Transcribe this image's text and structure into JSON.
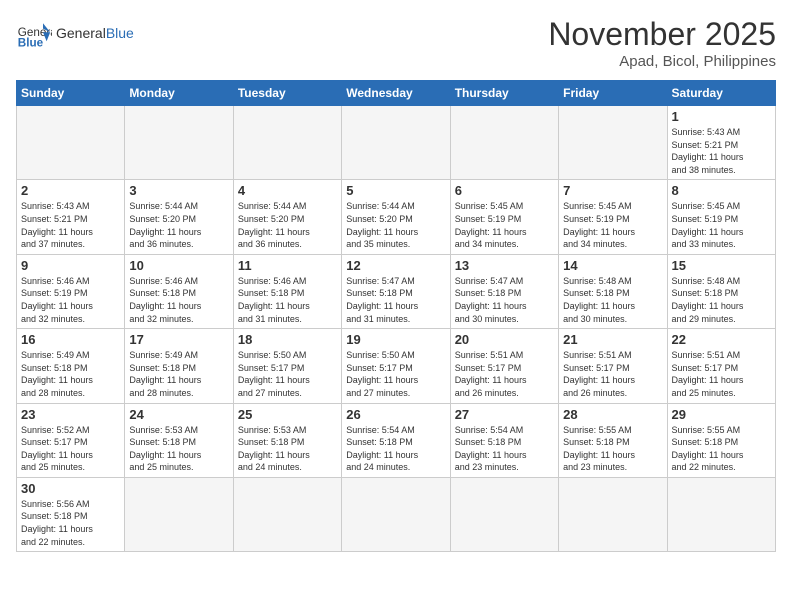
{
  "header": {
    "logo_general": "General",
    "logo_blue": "Blue",
    "month_title": "November 2025",
    "location": "Apad, Bicol, Philippines"
  },
  "weekdays": [
    "Sunday",
    "Monday",
    "Tuesday",
    "Wednesday",
    "Thursday",
    "Friday",
    "Saturday"
  ],
  "days": [
    {
      "num": "",
      "info": ""
    },
    {
      "num": "",
      "info": ""
    },
    {
      "num": "",
      "info": ""
    },
    {
      "num": "",
      "info": ""
    },
    {
      "num": "",
      "info": ""
    },
    {
      "num": "",
      "info": ""
    },
    {
      "num": "1",
      "info": "Sunrise: 5:43 AM\nSunset: 5:21 PM\nDaylight: 11 hours\nand 38 minutes."
    },
    {
      "num": "2",
      "info": "Sunrise: 5:43 AM\nSunset: 5:21 PM\nDaylight: 11 hours\nand 37 minutes."
    },
    {
      "num": "3",
      "info": "Sunrise: 5:44 AM\nSunset: 5:20 PM\nDaylight: 11 hours\nand 36 minutes."
    },
    {
      "num": "4",
      "info": "Sunrise: 5:44 AM\nSunset: 5:20 PM\nDaylight: 11 hours\nand 36 minutes."
    },
    {
      "num": "5",
      "info": "Sunrise: 5:44 AM\nSunset: 5:20 PM\nDaylight: 11 hours\nand 35 minutes."
    },
    {
      "num": "6",
      "info": "Sunrise: 5:45 AM\nSunset: 5:19 PM\nDaylight: 11 hours\nand 34 minutes."
    },
    {
      "num": "7",
      "info": "Sunrise: 5:45 AM\nSunset: 5:19 PM\nDaylight: 11 hours\nand 34 minutes."
    },
    {
      "num": "8",
      "info": "Sunrise: 5:45 AM\nSunset: 5:19 PM\nDaylight: 11 hours\nand 33 minutes."
    },
    {
      "num": "9",
      "info": "Sunrise: 5:46 AM\nSunset: 5:19 PM\nDaylight: 11 hours\nand 32 minutes."
    },
    {
      "num": "10",
      "info": "Sunrise: 5:46 AM\nSunset: 5:18 PM\nDaylight: 11 hours\nand 32 minutes."
    },
    {
      "num": "11",
      "info": "Sunrise: 5:46 AM\nSunset: 5:18 PM\nDaylight: 11 hours\nand 31 minutes."
    },
    {
      "num": "12",
      "info": "Sunrise: 5:47 AM\nSunset: 5:18 PM\nDaylight: 11 hours\nand 31 minutes."
    },
    {
      "num": "13",
      "info": "Sunrise: 5:47 AM\nSunset: 5:18 PM\nDaylight: 11 hours\nand 30 minutes."
    },
    {
      "num": "14",
      "info": "Sunrise: 5:48 AM\nSunset: 5:18 PM\nDaylight: 11 hours\nand 30 minutes."
    },
    {
      "num": "15",
      "info": "Sunrise: 5:48 AM\nSunset: 5:18 PM\nDaylight: 11 hours\nand 29 minutes."
    },
    {
      "num": "16",
      "info": "Sunrise: 5:49 AM\nSunset: 5:18 PM\nDaylight: 11 hours\nand 28 minutes."
    },
    {
      "num": "17",
      "info": "Sunrise: 5:49 AM\nSunset: 5:18 PM\nDaylight: 11 hours\nand 28 minutes."
    },
    {
      "num": "18",
      "info": "Sunrise: 5:50 AM\nSunset: 5:17 PM\nDaylight: 11 hours\nand 27 minutes."
    },
    {
      "num": "19",
      "info": "Sunrise: 5:50 AM\nSunset: 5:17 PM\nDaylight: 11 hours\nand 27 minutes."
    },
    {
      "num": "20",
      "info": "Sunrise: 5:51 AM\nSunset: 5:17 PM\nDaylight: 11 hours\nand 26 minutes."
    },
    {
      "num": "21",
      "info": "Sunrise: 5:51 AM\nSunset: 5:17 PM\nDaylight: 11 hours\nand 26 minutes."
    },
    {
      "num": "22",
      "info": "Sunrise: 5:51 AM\nSunset: 5:17 PM\nDaylight: 11 hours\nand 25 minutes."
    },
    {
      "num": "23",
      "info": "Sunrise: 5:52 AM\nSunset: 5:17 PM\nDaylight: 11 hours\nand 25 minutes."
    },
    {
      "num": "24",
      "info": "Sunrise: 5:53 AM\nSunset: 5:18 PM\nDaylight: 11 hours\nand 25 minutes."
    },
    {
      "num": "25",
      "info": "Sunrise: 5:53 AM\nSunset: 5:18 PM\nDaylight: 11 hours\nand 24 minutes."
    },
    {
      "num": "26",
      "info": "Sunrise: 5:54 AM\nSunset: 5:18 PM\nDaylight: 11 hours\nand 24 minutes."
    },
    {
      "num": "27",
      "info": "Sunrise: 5:54 AM\nSunset: 5:18 PM\nDaylight: 11 hours\nand 23 minutes."
    },
    {
      "num": "28",
      "info": "Sunrise: 5:55 AM\nSunset: 5:18 PM\nDaylight: 11 hours\nand 23 minutes."
    },
    {
      "num": "29",
      "info": "Sunrise: 5:55 AM\nSunset: 5:18 PM\nDaylight: 11 hours\nand 22 minutes."
    },
    {
      "num": "30",
      "info": "Sunrise: 5:56 AM\nSunset: 5:18 PM\nDaylight: 11 hours\nand 22 minutes."
    }
  ]
}
